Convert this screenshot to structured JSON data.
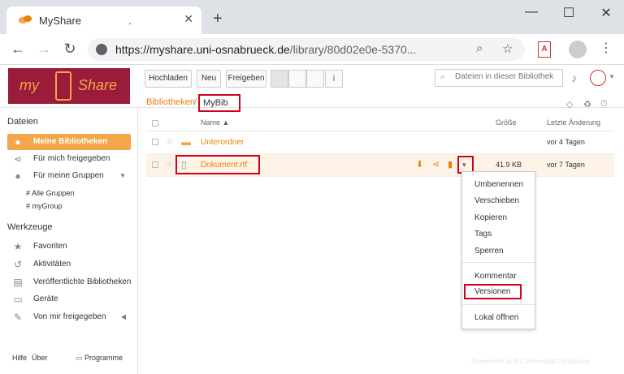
{
  "browser": {
    "tab_title": "MyShare",
    "tab_extra": ".",
    "close_glyph": "✕",
    "newtab_glyph": "+",
    "win_min": "—",
    "win_max": "☐",
    "win_close": "✕",
    "url_host": "https://myshare.uni-osnabrueck.de",
    "url_path": "/library/80d02e0e-5370..."
  },
  "app": {
    "logo_left": "my",
    "logo_right": "Share",
    "toolbar": {
      "upload": "Hochladen",
      "new": "Neu",
      "share": "Freigeben"
    },
    "search_placeholder": "Dateien in dieser Bibliothek"
  },
  "sidebar": {
    "files_heading": "Dateien",
    "items": [
      {
        "label": "Meine Bibliotheken",
        "icon": "user-icon"
      },
      {
        "label": "Für mich freigegeben",
        "icon": "share-icon"
      },
      {
        "label": "Für meine Gruppen",
        "icon": "group-icon"
      }
    ],
    "groups": [
      "# Alle Gruppen",
      "# myGroup"
    ],
    "tools_heading": "Werkzeuge",
    "tools": [
      {
        "label": "Favoriten",
        "icon": "star-icon"
      },
      {
        "label": "Aktivitäten",
        "icon": "history-icon"
      },
      {
        "label": "Veröffentlichte Bibliotheken",
        "icon": "book-icon"
      },
      {
        "label": "Geräte",
        "icon": "monitor-icon"
      },
      {
        "label": "Von mir freigegeben",
        "icon": "wrench-icon"
      }
    ],
    "footer": {
      "help": "Hilfe",
      "about": "Über",
      "programs": "Programme"
    }
  },
  "content": {
    "breadcrumb_root": "Bibliotheken",
    "breadcrumb_sep": "/",
    "breadcrumb_current": "MyBib",
    "columns": {
      "name": "Name ▲",
      "size": "Größe",
      "modified": "Letzte Änderung"
    },
    "rows": [
      {
        "name": "Unterordner",
        "size": "",
        "modified": "vor 4 Tagen",
        "type": "folder"
      },
      {
        "name": "Dokument.rtf",
        "size": "41.9 KB",
        "modified": "vor 7 Tagen",
        "type": "file"
      }
    ],
    "menu": [
      "Umbenennen",
      "Verschieben",
      "Kopieren",
      "Tags",
      "Sperren",
      "Kommentar",
      "Versionen",
      "Lokal öffnen"
    ]
  },
  "watermark": "Screenshot by RZ Universität Osnabrück",
  "colors": {
    "accent": "#eb8205",
    "highlight": "#d0021b",
    "brand": "#9b1b3a"
  }
}
